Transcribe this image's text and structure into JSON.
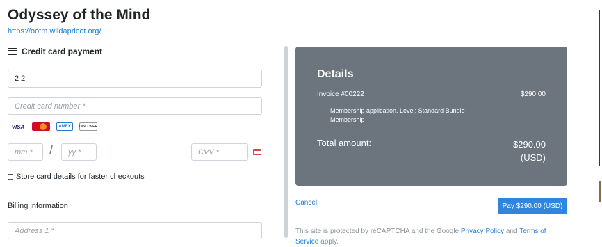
{
  "org": {
    "title": "Odyssey of the Mind",
    "url": "https://ootm.wildapricot.org/"
  },
  "payment": {
    "heading": "Credit card payment",
    "name_value": "2 2",
    "card_placeholder": "Credit card number *",
    "card_brands": [
      "VISA",
      "MasterCard",
      "AMEX",
      "DISCOVER"
    ],
    "mm_placeholder": "mm *",
    "slash": "/",
    "yy_placeholder": "yy *",
    "cvv_placeholder": "CVV *",
    "store_label": "Store card details for faster checkouts",
    "billing_label": "Billing information",
    "address_placeholder": "Address 1 *"
  },
  "details": {
    "title": "Details",
    "invoice_label": "Invoice #00222",
    "invoice_amount": "$290.00",
    "description": "Membership application. Level: Standard Bundle Membership",
    "total_label": "Total amount:",
    "total_amount": "$290.00",
    "total_currency": "(USD)"
  },
  "actions": {
    "cancel": "Cancel",
    "pay": "Pay $290.00 (USD)"
  },
  "recaptcha": {
    "prefix": "This site is protected by reCAPTCHA and the Google ",
    "privacy": "Privacy Policy",
    "and": " and ",
    "terms_a": "Terms of",
    "terms_b": "Service",
    "suffix": " apply."
  },
  "colors": {
    "accent": "#2e86de",
    "link": "#1f7fd6",
    "details_bg": "#6c757d"
  }
}
